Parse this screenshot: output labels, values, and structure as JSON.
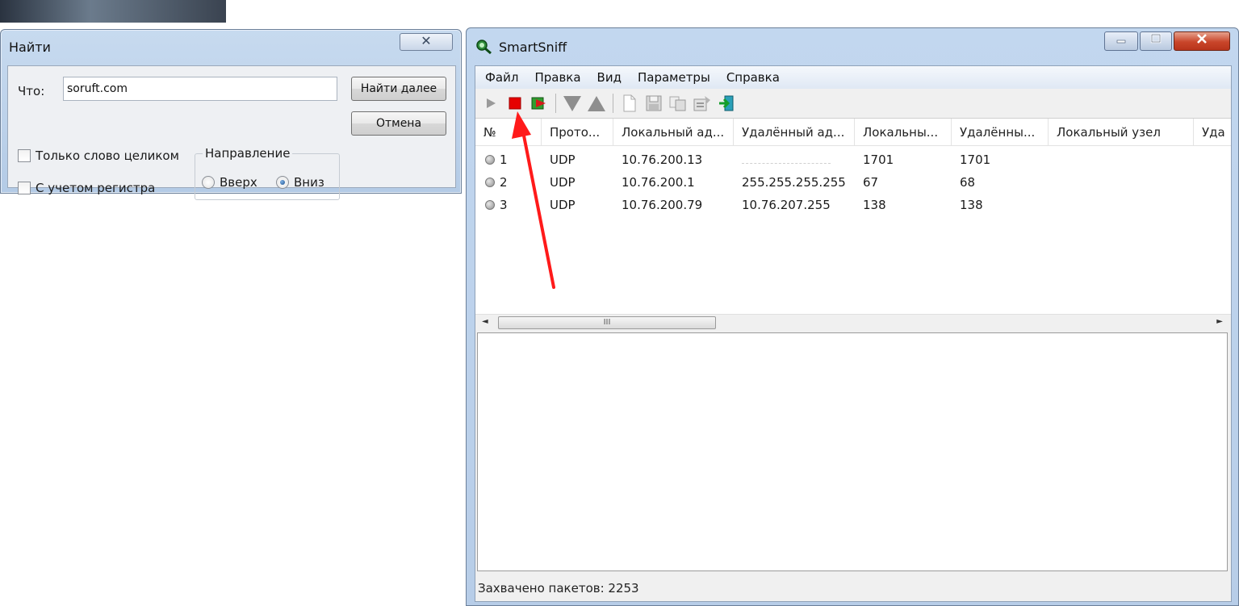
{
  "find_dialog": {
    "title": "Найти",
    "close_label": "✕",
    "what_label": "Что:",
    "what_value": "soruft.com",
    "find_next_label": "Найти далее",
    "cancel_label": "Отмена",
    "whole_word_label": "Только слово целиком",
    "match_case_label": "С учетом регистра",
    "direction": {
      "legend": "Направление",
      "up_label": "Вверх",
      "down_label": "Вниз",
      "selected": "down"
    }
  },
  "smartsniff": {
    "title": "SmartSniff",
    "menu": [
      "Файл",
      "Правка",
      "Вид",
      "Параметры",
      "Справка"
    ],
    "toolbar_icons": [
      "play-icon",
      "stop-icon",
      "start-resume-icon",
      "arrow-down-icon",
      "arrow-up-icon",
      "new-file-icon",
      "save-icon",
      "copy-icon",
      "properties-icon",
      "exit-icon"
    ],
    "columns": [
      "№",
      "Прото...",
      "Локальный ад...",
      "Удалённый ад...",
      "Локальны...",
      "Удалённы...",
      "Локальный узел",
      "Уда"
    ],
    "rows": [
      {
        "no": "1",
        "proto": "UDP",
        "local_addr": "10.76.200.13",
        "remote_addr": "",
        "local_port": "1701",
        "remote_port": "1701"
      },
      {
        "no": "2",
        "proto": "UDP",
        "local_addr": "10.76.200.1",
        "remote_addr": "255.255.255.255",
        "local_port": "67",
        "remote_port": "68"
      },
      {
        "no": "3",
        "proto": "UDP",
        "local_addr": "10.76.200.79",
        "remote_addr": "10.76.207.255",
        "local_port": "138",
        "remote_port": "138"
      }
    ],
    "status": "Захвачено пакетов: 2253",
    "scroll_grip": "III"
  },
  "colors": {
    "accent_arrow": "#ff1a1a",
    "stop_red": "#e60000",
    "title_bar": "#c2d7ef"
  }
}
